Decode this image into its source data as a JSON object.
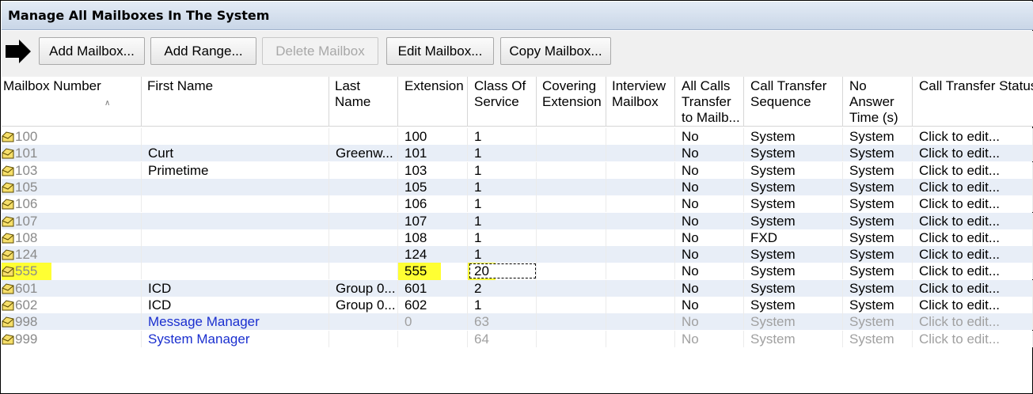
{
  "window": {
    "title": "Manage All Mailboxes In The System"
  },
  "toolbar": {
    "add_mailbox": "Add Mailbox...",
    "add_range": "Add Range...",
    "delete_mailbox": "Delete Mailbox",
    "edit_mailbox": "Edit Mailbox...",
    "copy_mailbox": "Copy Mailbox..."
  },
  "columns": {
    "mailbox_number": "Mailbox Number",
    "first_name": "First Name",
    "last_name_1": "Last",
    "last_name_2": "Name",
    "extension": "Extension",
    "cos_1": "Class Of",
    "cos_2": "Service",
    "cov_1": "Covering",
    "cov_2": "Extension",
    "int_1": "Interview",
    "int_2": "Mailbox",
    "all_1": "All Calls",
    "all_2": "Transfer",
    "all_3": "to Mailb...",
    "cts_1": "Call Transfer",
    "cts_2": "Sequence",
    "nat_1": "No",
    "nat_2": "Answer",
    "nat_3": "Time (s)",
    "status": "Call Transfer Status"
  },
  "rows": [
    {
      "mailbox": "100",
      "first": "",
      "last": "",
      "ext": "100",
      "cos": "1",
      "cov": "",
      "interview": "",
      "all": "No",
      "seq": "System",
      "nat": "System",
      "status": "Click to edit..."
    },
    {
      "mailbox": "101",
      "first": "Curt",
      "last": "Greenw...",
      "ext": "101",
      "cos": "1",
      "cov": "",
      "interview": "",
      "all": "No",
      "seq": "System",
      "nat": "System",
      "status": "Click to edit..."
    },
    {
      "mailbox": "103",
      "first": "Primetime",
      "last": "",
      "ext": "103",
      "cos": "1",
      "cov": "",
      "interview": "",
      "all": "No",
      "seq": "System",
      "nat": "System",
      "status": "Click to edit..."
    },
    {
      "mailbox": "105",
      "first": "",
      "last": "",
      "ext": "105",
      "cos": "1",
      "cov": "",
      "interview": "",
      "all": "No",
      "seq": "System",
      "nat": "System",
      "status": "Click to edit..."
    },
    {
      "mailbox": "106",
      "first": "",
      "last": "",
      "ext": "106",
      "cos": "1",
      "cov": "",
      "interview": "",
      "all": "No",
      "seq": "System",
      "nat": "System",
      "status": "Click to edit..."
    },
    {
      "mailbox": "107",
      "first": "",
      "last": "",
      "ext": "107",
      "cos": "1",
      "cov": "",
      "interview": "",
      "all": "No",
      "seq": "System",
      "nat": "System",
      "status": "Click to edit..."
    },
    {
      "mailbox": "108",
      "first": "",
      "last": "",
      "ext": "108",
      "cos": "1",
      "cov": "",
      "interview": "",
      "all": "No",
      "seq": "FXD",
      "nat": "System",
      "status": "Click to edit..."
    },
    {
      "mailbox": "124",
      "first": "",
      "last": "",
      "ext": "124",
      "cos": "1",
      "cov": "",
      "interview": "",
      "all": "No",
      "seq": "System",
      "nat": "System",
      "status": "Click to edit..."
    },
    {
      "mailbox": "555",
      "first": "",
      "last": "",
      "ext": "555",
      "cos": "20",
      "cov": "",
      "interview": "",
      "all": "No",
      "seq": "System",
      "nat": "System",
      "status": "Click to edit..."
    },
    {
      "mailbox": "601",
      "first": "ICD",
      "last": "Group 0...",
      "ext": "601",
      "cos": "2",
      "cov": "",
      "interview": "",
      "all": "No",
      "seq": "System",
      "nat": "System",
      "status": "Click to edit..."
    },
    {
      "mailbox": "602",
      "first": "ICD",
      "last": "Group 0...",
      "ext": "602",
      "cos": "1",
      "cov": "",
      "interview": "",
      "all": "No",
      "seq": "System",
      "nat": "System",
      "status": "Click to edit..."
    },
    {
      "mailbox": "998",
      "first": "Message Manager",
      "last": "",
      "ext": "0",
      "cos": "63",
      "cov": "",
      "interview": "",
      "all": "No",
      "seq": "System",
      "nat": "System",
      "status": "Click to edit..."
    },
    {
      "mailbox": "999",
      "first": "System Manager",
      "last": "",
      "ext": "",
      "cos": "64",
      "cov": "",
      "interview": "",
      "all": "No",
      "seq": "System",
      "nat": "System",
      "status": "Click to edit..."
    }
  ],
  "colors": {
    "highlight": "#ffff33",
    "link": "#1a2fcf",
    "alt_row": "#e8eef7"
  }
}
